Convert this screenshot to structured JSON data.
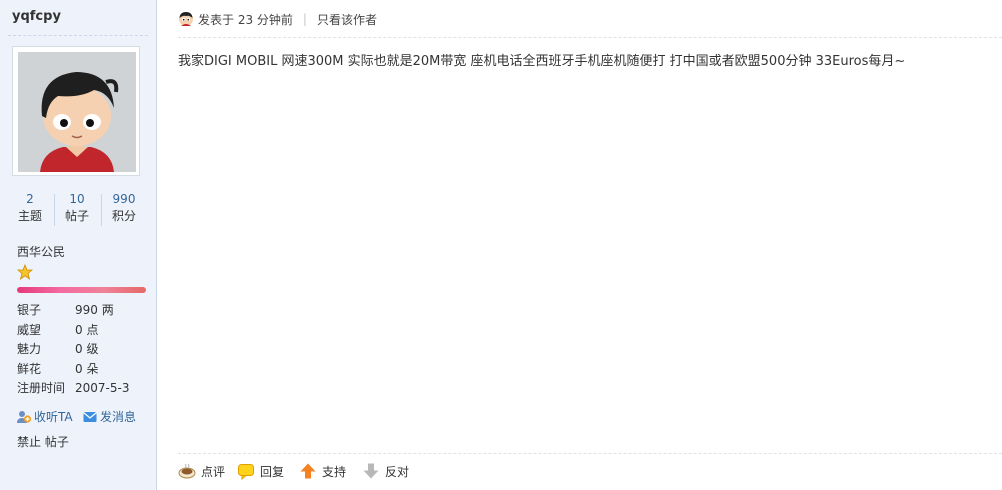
{
  "user": {
    "username": "yqfcpy",
    "stats": [
      {
        "value": "2",
        "label": "主题"
      },
      {
        "value": "10",
        "label": "帖子"
      },
      {
        "value": "990",
        "label": "积分"
      }
    ],
    "group": "西华公民",
    "info": [
      {
        "key": "银子",
        "value": "990 两"
      },
      {
        "key": "威望",
        "value": "0 点"
      },
      {
        "key": "魅力",
        "value": "0 级"
      },
      {
        "key": "鲜花",
        "value": "0 朵"
      },
      {
        "key": "注册时间",
        "value": "2007-5-3"
      }
    ],
    "follow_label": "收听TA",
    "message_label": "发消息",
    "ban_label": "禁止 帖子"
  },
  "post": {
    "posted_text": "发表于 23 分钟前",
    "separator": "|",
    "author_only_label": "只看该作者",
    "content": "我家DIGI MOBIL 网速300M 实际也就是20M带宽 座机电话全西班牙手机座机随便打 打中国或者欧盟500分钟 33Euros每月~"
  },
  "footer": {
    "rate_label": "点评",
    "reply_label": "回复",
    "support_label": "支持",
    "oppose_label": "反对"
  },
  "colors": {
    "link": "#336699",
    "sidebar_bg": "#eef3fb",
    "level_bar": "#e5397c"
  },
  "icons": [
    "user-avatar-small-icon",
    "star-icon",
    "follow-icon",
    "message-icon",
    "rate-icon",
    "reply-icon",
    "support-arrow-icon",
    "oppose-arrow-icon"
  ]
}
